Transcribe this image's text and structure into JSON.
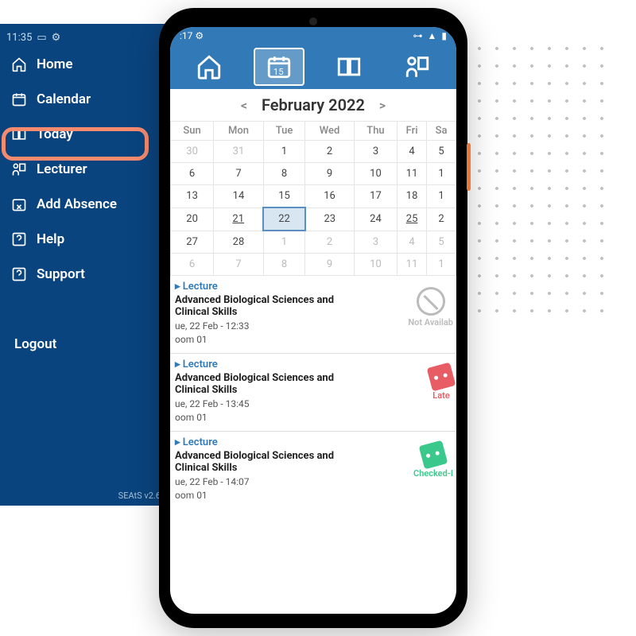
{
  "sidebar": {
    "status_time": "11:35",
    "items": [
      {
        "label": "Home",
        "icon": "home"
      },
      {
        "label": "Calendar",
        "icon": "calendar",
        "active": true
      },
      {
        "label": "Today",
        "icon": "book"
      },
      {
        "label": "Lecturer",
        "icon": "lecturer"
      },
      {
        "label": "Add Absence",
        "icon": "absence"
      },
      {
        "label": "Help",
        "icon": "help"
      },
      {
        "label": "Support",
        "icon": "support"
      }
    ],
    "logout": "Logout",
    "version": "SEAtS v2.6"
  },
  "phone": {
    "status_time": ":17",
    "toolbar": [
      "home",
      "calendar",
      "book",
      "lecturer"
    ],
    "toolbar_selected": 1,
    "calendar": {
      "month_label": "February 2022",
      "day_headers": [
        "Sun",
        "Mon",
        "Tue",
        "Wed",
        "Thu",
        "Fri",
        "Sa"
      ],
      "rows": [
        [
          {
            "d": "30",
            "mute": true
          },
          {
            "d": "31",
            "mute": true
          },
          {
            "d": "1"
          },
          {
            "d": "2"
          },
          {
            "d": "3"
          },
          {
            "d": "4"
          },
          {
            "d": "5"
          }
        ],
        [
          {
            "d": "6"
          },
          {
            "d": "7"
          },
          {
            "d": "8"
          },
          {
            "d": "9"
          },
          {
            "d": "10"
          },
          {
            "d": "11"
          },
          {
            "d": "1"
          }
        ],
        [
          {
            "d": "13"
          },
          {
            "d": "14"
          },
          {
            "d": "15"
          },
          {
            "d": "16"
          },
          {
            "d": "17"
          },
          {
            "d": "18"
          },
          {
            "d": "1"
          }
        ],
        [
          {
            "d": "20"
          },
          {
            "d": "21",
            "under": true
          },
          {
            "d": "22",
            "sel": true
          },
          {
            "d": "23"
          },
          {
            "d": "24"
          },
          {
            "d": "25",
            "under": true
          },
          {
            "d": "2"
          }
        ],
        [
          {
            "d": "27"
          },
          {
            "d": "28"
          },
          {
            "d": "1",
            "mute": true
          },
          {
            "d": "2",
            "mute": true
          },
          {
            "d": "3",
            "mute": true
          },
          {
            "d": "4",
            "mute": true
          },
          {
            "d": "5",
            "mute": true
          }
        ],
        [
          {
            "d": "6",
            "mute": true
          },
          {
            "d": "7",
            "mute": true
          },
          {
            "d": "8",
            "mute": true
          },
          {
            "d": "9",
            "mute": true
          },
          {
            "d": "10",
            "mute": true
          },
          {
            "d": "11",
            "mute": true
          },
          {
            "d": "1",
            "mute": true
          }
        ]
      ]
    },
    "events": [
      {
        "type": "Lecture",
        "title": "Advanced Biological Sciences and Clinical Skills",
        "datetime": "ue, 22 Feb - 12:33",
        "room": "oom 01",
        "status": "Not Availab",
        "status_kind": "na"
      },
      {
        "type": "Lecture",
        "title": "Advanced Biological Sciences and Clinical Skills",
        "datetime": "ue, 22 Feb - 13:45",
        "room": "oom 01",
        "status": "Late",
        "status_kind": "late"
      },
      {
        "type": "Lecture",
        "title": "Advanced Biological Sciences and Clinical Skills",
        "datetime": "ue, 22 Feb - 14:07",
        "room": "oom 01",
        "status": "Checked-I",
        "status_kind": "ok"
      }
    ]
  }
}
